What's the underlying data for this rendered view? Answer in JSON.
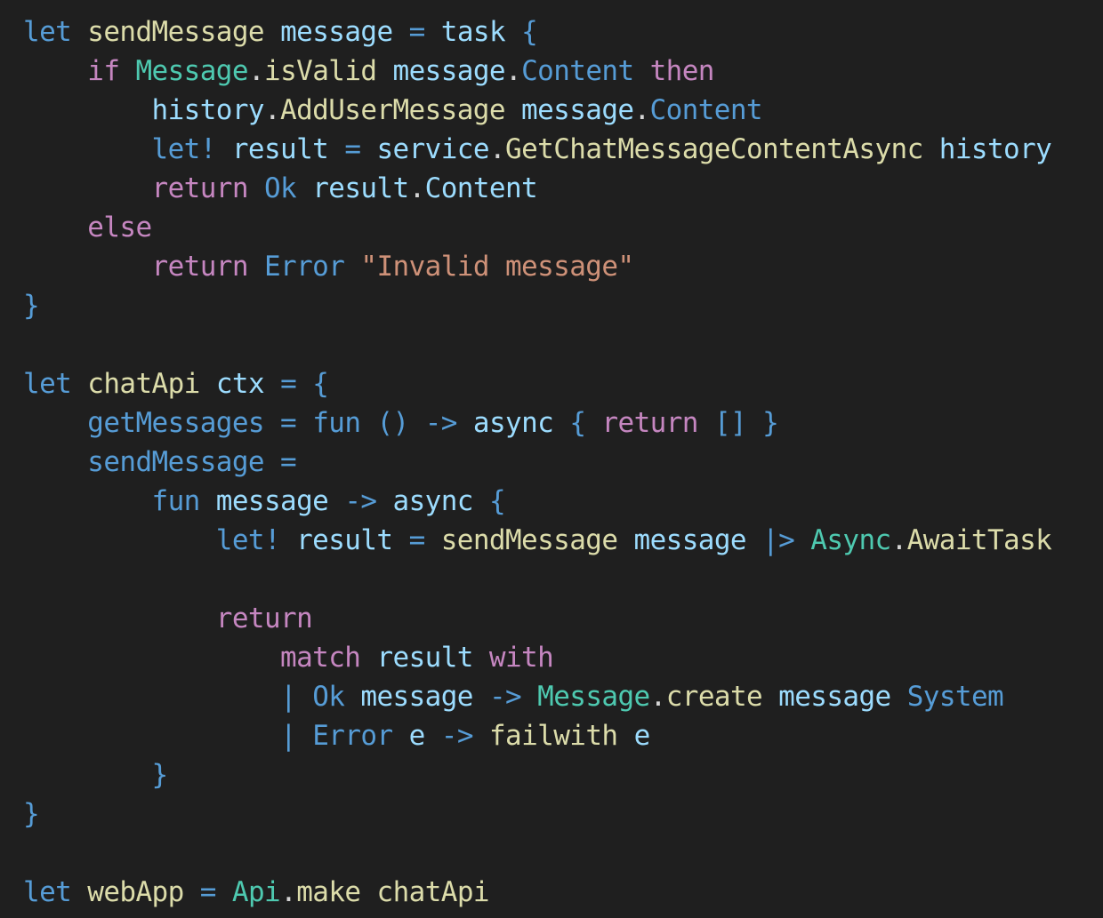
{
  "editor": {
    "lines": [
      [
        {
          "t": "let",
          "c": "kw"
        },
        {
          "t": " ",
          "c": "punc"
        },
        {
          "t": "sendMessage",
          "c": "fn"
        },
        {
          "t": " ",
          "c": "punc"
        },
        {
          "t": "message",
          "c": "var"
        },
        {
          "t": " ",
          "c": "punc"
        },
        {
          "t": "=",
          "c": "op"
        },
        {
          "t": " ",
          "c": "punc"
        },
        {
          "t": "task",
          "c": "var"
        },
        {
          "t": " ",
          "c": "punc"
        },
        {
          "t": "{",
          "c": "brace"
        }
      ],
      [
        {
          "t": "    ",
          "c": "punc"
        },
        {
          "t": "if",
          "c": "ctl"
        },
        {
          "t": " ",
          "c": "punc"
        },
        {
          "t": "Message",
          "c": "type"
        },
        {
          "t": ".",
          "c": "punc"
        },
        {
          "t": "isValid",
          "c": "fn"
        },
        {
          "t": " ",
          "c": "punc"
        },
        {
          "t": "message",
          "c": "var"
        },
        {
          "t": ".",
          "c": "punc"
        },
        {
          "t": "Content",
          "c": "kw"
        },
        {
          "t": " ",
          "c": "punc"
        },
        {
          "t": "then",
          "c": "ctl"
        }
      ],
      [
        {
          "t": "        ",
          "c": "punc"
        },
        {
          "t": "history",
          "c": "var"
        },
        {
          "t": ".",
          "c": "punc"
        },
        {
          "t": "AddUserMessage",
          "c": "fn"
        },
        {
          "t": " ",
          "c": "punc"
        },
        {
          "t": "message",
          "c": "var"
        },
        {
          "t": ".",
          "c": "punc"
        },
        {
          "t": "Content",
          "c": "kw"
        }
      ],
      [
        {
          "t": "        ",
          "c": "punc"
        },
        {
          "t": "let!",
          "c": "kw"
        },
        {
          "t": " ",
          "c": "punc"
        },
        {
          "t": "result",
          "c": "var"
        },
        {
          "t": " ",
          "c": "punc"
        },
        {
          "t": "=",
          "c": "op"
        },
        {
          "t": " ",
          "c": "punc"
        },
        {
          "t": "service",
          "c": "var"
        },
        {
          "t": ".",
          "c": "punc"
        },
        {
          "t": "GetChatMessageContentAsync",
          "c": "fn"
        },
        {
          "t": " ",
          "c": "punc"
        },
        {
          "t": "history",
          "c": "var"
        }
      ],
      [
        {
          "t": "        ",
          "c": "punc"
        },
        {
          "t": "return",
          "c": "ctl"
        },
        {
          "t": " ",
          "c": "punc"
        },
        {
          "t": "Ok",
          "c": "kw"
        },
        {
          "t": " ",
          "c": "punc"
        },
        {
          "t": "result",
          "c": "var"
        },
        {
          "t": ".",
          "c": "punc"
        },
        {
          "t": "Content",
          "c": "var"
        }
      ],
      [
        {
          "t": "    ",
          "c": "punc"
        },
        {
          "t": "else",
          "c": "ctl"
        }
      ],
      [
        {
          "t": "        ",
          "c": "punc"
        },
        {
          "t": "return",
          "c": "ctl"
        },
        {
          "t": " ",
          "c": "punc"
        },
        {
          "t": "Error",
          "c": "kw"
        },
        {
          "t": " ",
          "c": "punc"
        },
        {
          "t": "\"Invalid message\"",
          "c": "str"
        }
      ],
      [
        {
          "t": "}",
          "c": "brace"
        }
      ],
      [],
      [
        {
          "t": "let",
          "c": "kw"
        },
        {
          "t": " ",
          "c": "punc"
        },
        {
          "t": "chatApi",
          "c": "fn"
        },
        {
          "t": " ",
          "c": "punc"
        },
        {
          "t": "ctx",
          "c": "var"
        },
        {
          "t": " ",
          "c": "punc"
        },
        {
          "t": "=",
          "c": "op"
        },
        {
          "t": " ",
          "c": "punc"
        },
        {
          "t": "{",
          "c": "brace"
        }
      ],
      [
        {
          "t": "    ",
          "c": "punc"
        },
        {
          "t": "getMessages",
          "c": "kw"
        },
        {
          "t": " ",
          "c": "punc"
        },
        {
          "t": "=",
          "c": "op"
        },
        {
          "t": " ",
          "c": "punc"
        },
        {
          "t": "fun",
          "c": "kw"
        },
        {
          "t": " ",
          "c": "punc"
        },
        {
          "t": "()",
          "c": "kw"
        },
        {
          "t": " ",
          "c": "punc"
        },
        {
          "t": "->",
          "c": "kw"
        },
        {
          "t": " ",
          "c": "punc"
        },
        {
          "t": "async",
          "c": "var"
        },
        {
          "t": " ",
          "c": "punc"
        },
        {
          "t": "{",
          "c": "brace"
        },
        {
          "t": " ",
          "c": "punc"
        },
        {
          "t": "return",
          "c": "ctl"
        },
        {
          "t": " ",
          "c": "punc"
        },
        {
          "t": "[]",
          "c": "kw"
        },
        {
          "t": " ",
          "c": "punc"
        },
        {
          "t": "}",
          "c": "brace"
        }
      ],
      [
        {
          "t": "    ",
          "c": "punc"
        },
        {
          "t": "sendMessage",
          "c": "kw"
        },
        {
          "t": " ",
          "c": "punc"
        },
        {
          "t": "=",
          "c": "op"
        }
      ],
      [
        {
          "t": "        ",
          "c": "punc"
        },
        {
          "t": "fun",
          "c": "kw"
        },
        {
          "t": " ",
          "c": "punc"
        },
        {
          "t": "message",
          "c": "var"
        },
        {
          "t": " ",
          "c": "punc"
        },
        {
          "t": "->",
          "c": "kw"
        },
        {
          "t": " ",
          "c": "punc"
        },
        {
          "t": "async",
          "c": "var"
        },
        {
          "t": " ",
          "c": "punc"
        },
        {
          "t": "{",
          "c": "brace"
        }
      ],
      [
        {
          "t": "            ",
          "c": "punc"
        },
        {
          "t": "let!",
          "c": "kw"
        },
        {
          "t": " ",
          "c": "punc"
        },
        {
          "t": "result",
          "c": "var"
        },
        {
          "t": " ",
          "c": "punc"
        },
        {
          "t": "=",
          "c": "op"
        },
        {
          "t": " ",
          "c": "punc"
        },
        {
          "t": "sendMessage",
          "c": "fn"
        },
        {
          "t": " ",
          "c": "punc"
        },
        {
          "t": "message",
          "c": "var"
        },
        {
          "t": " ",
          "c": "punc"
        },
        {
          "t": "|>",
          "c": "kw"
        },
        {
          "t": " ",
          "c": "punc"
        },
        {
          "t": "Async",
          "c": "type"
        },
        {
          "t": ".",
          "c": "punc"
        },
        {
          "t": "AwaitTask",
          "c": "fn"
        }
      ],
      [],
      [
        {
          "t": "            ",
          "c": "punc"
        },
        {
          "t": "return",
          "c": "ctl"
        }
      ],
      [
        {
          "t": "                ",
          "c": "punc"
        },
        {
          "t": "match",
          "c": "ctl"
        },
        {
          "t": " ",
          "c": "punc"
        },
        {
          "t": "result",
          "c": "var"
        },
        {
          "t": " ",
          "c": "punc"
        },
        {
          "t": "with",
          "c": "ctl"
        }
      ],
      [
        {
          "t": "                ",
          "c": "punc"
        },
        {
          "t": "|",
          "c": "kw"
        },
        {
          "t": " ",
          "c": "punc"
        },
        {
          "t": "Ok",
          "c": "kw"
        },
        {
          "t": " ",
          "c": "punc"
        },
        {
          "t": "message",
          "c": "var"
        },
        {
          "t": " ",
          "c": "punc"
        },
        {
          "t": "->",
          "c": "kw"
        },
        {
          "t": " ",
          "c": "punc"
        },
        {
          "t": "Message",
          "c": "type"
        },
        {
          "t": ".",
          "c": "punc"
        },
        {
          "t": "create",
          "c": "fn"
        },
        {
          "t": " ",
          "c": "punc"
        },
        {
          "t": "message",
          "c": "var"
        },
        {
          "t": " ",
          "c": "punc"
        },
        {
          "t": "System",
          "c": "kw"
        }
      ],
      [
        {
          "t": "                ",
          "c": "punc"
        },
        {
          "t": "|",
          "c": "kw"
        },
        {
          "t": " ",
          "c": "punc"
        },
        {
          "t": "Error",
          "c": "kw"
        },
        {
          "t": " ",
          "c": "punc"
        },
        {
          "t": "e",
          "c": "var"
        },
        {
          "t": " ",
          "c": "punc"
        },
        {
          "t": "->",
          "c": "kw"
        },
        {
          "t": " ",
          "c": "punc"
        },
        {
          "t": "failwith",
          "c": "fn"
        },
        {
          "t": " ",
          "c": "punc"
        },
        {
          "t": "e",
          "c": "var"
        }
      ],
      [
        {
          "t": "        ",
          "c": "punc"
        },
        {
          "t": "}",
          "c": "brace"
        }
      ],
      [
        {
          "t": "}",
          "c": "brace"
        }
      ],
      [],
      [
        {
          "t": "let",
          "c": "kw"
        },
        {
          "t": " ",
          "c": "punc"
        },
        {
          "t": "webApp",
          "c": "fn"
        },
        {
          "t": " ",
          "c": "punc"
        },
        {
          "t": "=",
          "c": "op"
        },
        {
          "t": " ",
          "c": "punc"
        },
        {
          "t": "Api",
          "c": "type"
        },
        {
          "t": ".",
          "c": "punc"
        },
        {
          "t": "make",
          "c": "fn"
        },
        {
          "t": " ",
          "c": "punc"
        },
        {
          "t": "chatApi",
          "c": "fn"
        }
      ]
    ]
  }
}
